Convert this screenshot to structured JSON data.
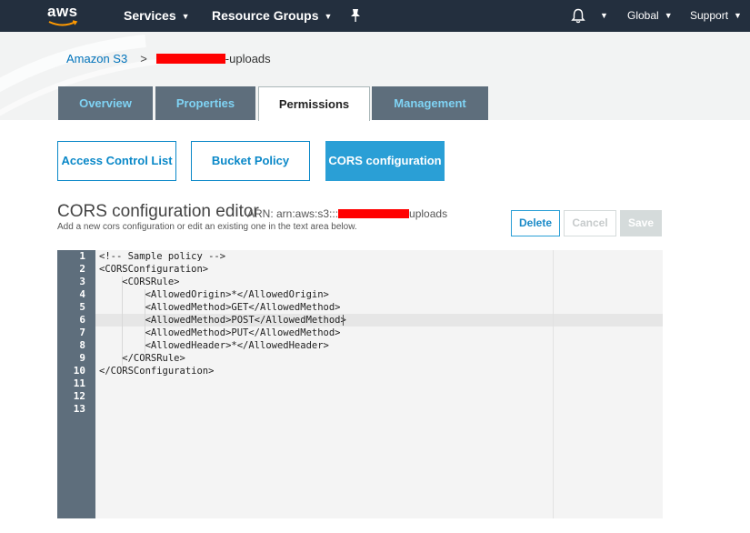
{
  "topnav": {
    "logo_text": "aws",
    "services_label": "Services",
    "resource_groups_label": "Resource Groups",
    "region_label": "Global",
    "support_label": "Support",
    "icons": [
      "pin-icon",
      "bell-icon",
      "chevron-down-icon"
    ]
  },
  "breadcrumb": {
    "root": "Amazon S3",
    "separator": ">",
    "bucket_suffix": "-uploads"
  },
  "tabs": [
    {
      "label": "Overview",
      "active": false
    },
    {
      "label": "Properties",
      "active": false
    },
    {
      "label": "Permissions",
      "active": true
    },
    {
      "label": "Management",
      "active": false
    }
  ],
  "subtabs": [
    {
      "label": "Access Control List",
      "active": false
    },
    {
      "label": "Bucket Policy",
      "active": false
    },
    {
      "label": "CORS configuration",
      "active": true
    }
  ],
  "editor": {
    "title": "CORS configuration editor",
    "arn_prefix": "ARN: arn:aws:s3:::",
    "arn_suffix": "uploads",
    "subtitle": "Add a new cors configuration or edit an existing one in the text area below.",
    "buttons": {
      "delete": "Delete",
      "cancel": "Cancel",
      "save": "Save"
    },
    "lines": [
      {
        "num": "1",
        "text": "<!-- Sample policy -->"
      },
      {
        "num": "2",
        "text": "<CORSConfiguration>"
      },
      {
        "num": "3",
        "text": "    <CORSRule>"
      },
      {
        "num": "4",
        "text": "        <AllowedOrigin>*</AllowedOrigin>"
      },
      {
        "num": "5",
        "text": "        <AllowedMethod>GET</AllowedMethod>"
      },
      {
        "num": "6",
        "text": "        <AllowedMethod>POST</AllowedMethod>"
      },
      {
        "num": "7",
        "text": "        <AllowedMethod>PUT</AllowedMethod>"
      },
      {
        "num": "8",
        "text": "        <AllowedHeader>*</AllowedHeader>"
      },
      {
        "num": "9",
        "text": "    </CORSRule>"
      },
      {
        "num": "10",
        "text": "</CORSConfiguration>"
      },
      {
        "num": "11",
        "text": ""
      },
      {
        "num": "12",
        "text": ""
      },
      {
        "num": "13",
        "text": ""
      }
    ]
  },
  "colors": {
    "nav_bg": "#232f3e",
    "tab_dark": "#5e6e7c",
    "tab_text": "#7fd3f4",
    "link": "#0073bb",
    "accent": "#2a9fd6",
    "redaction": "#ff0000"
  }
}
